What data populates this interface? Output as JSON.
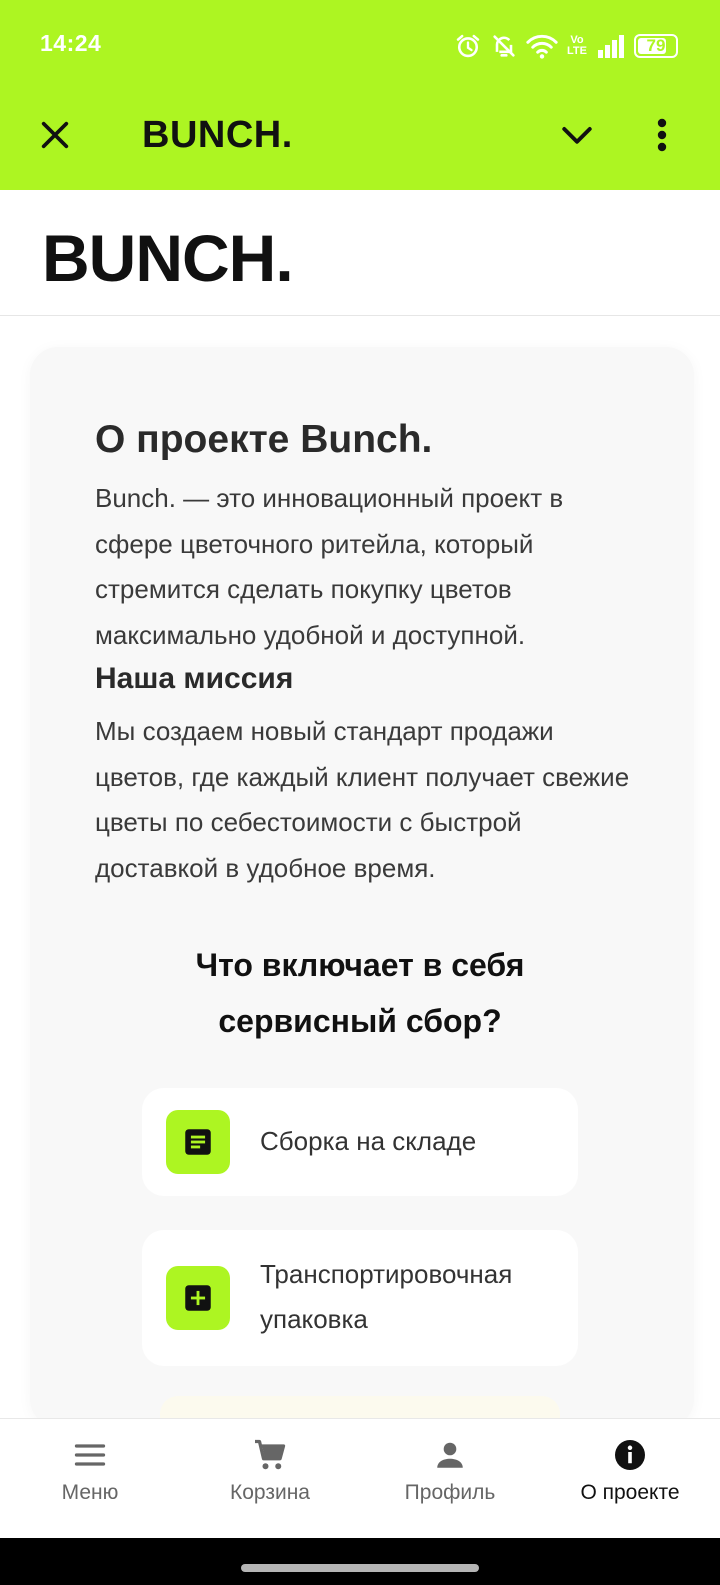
{
  "status_bar": {
    "time": "14:24",
    "icons": [
      "alarm-icon",
      "bell-off-icon",
      "wifi-icon",
      "volte-icon",
      "signal-icon"
    ],
    "volte_label": "Vo LTE",
    "battery_percent": "79",
    "battery_level": 0.79
  },
  "app_bar": {
    "title": "BUNCH.",
    "close_icon": "close-icon",
    "expand_icon": "chevron-down-icon",
    "more_icon": "more-vert-icon"
  },
  "brand": {
    "logo_text": "BUNCH."
  },
  "about": {
    "title": "О проекте Bunch.",
    "text": "Bunch. — это инновационный проект в сфере цветочного ритейла, который стремится сделать покупку цветов максимально удобной и доступной.",
    "mission_title": "Наша миссия",
    "mission_text": "Мы создаем новый стандарт продажи цветов, где каждый клиент получает свежие цветы по себестоимости с быстрой доставкой в удобное время."
  },
  "service_fee": {
    "title": "Что включает в себя сервисный сбор?",
    "items": [
      {
        "label": "Сборка на складе",
        "icon": "notes-icon"
      },
      {
        "label": "Транспортировочная упаковка",
        "icon": "add-box-icon"
      }
    ]
  },
  "bottom_nav": {
    "items": [
      {
        "label": "Меню",
        "icon": "menu-icon",
        "active": false
      },
      {
        "label": "Корзина",
        "icon": "cart-icon",
        "active": false
      },
      {
        "label": "Профиль",
        "icon": "person-icon",
        "active": false
      },
      {
        "label": "О проекте",
        "icon": "info-icon",
        "active": true
      }
    ]
  },
  "colors": {
    "accent": "#adf522",
    "card_background": "#f8f8f8",
    "text_dark": "#111111"
  }
}
